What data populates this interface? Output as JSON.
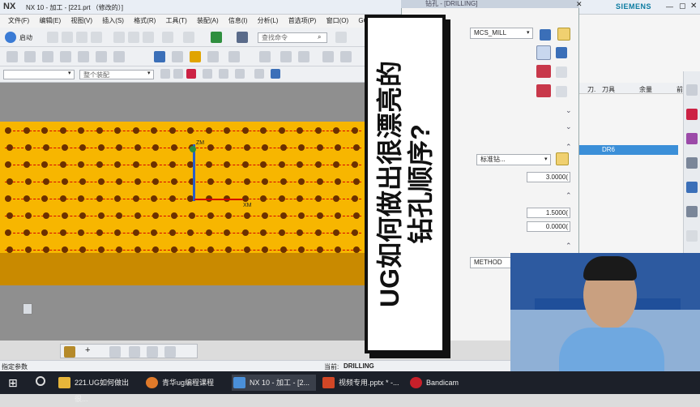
{
  "window": {
    "logo": "NX",
    "title": "NX 10 - 加工 - [221.prt （修改的）]",
    "brand": "SIEMENS"
  },
  "menu": [
    "文件(F)",
    "编辑(E)",
    "视图(V)",
    "插入(S)",
    "格式(R)",
    "工具(T)",
    "装配(A)",
    "信息(I)",
    "分析(L)",
    "首选项(P)",
    "窗口(O)",
    "GC工具箱"
  ],
  "toolbar": {
    "start_label": "启动",
    "search_placeholder": "查找命令",
    "filter1": "",
    "filter2": "整个装配"
  },
  "dialog": {
    "title": "钻孔 - [DRILLING]",
    "geometry_value": "MCS_MILL",
    "cycle_value": "标准钻...",
    "value1": "3.0000(",
    "value2": "1.5000(",
    "value3": "0.0000(",
    "method_value": "METHOD"
  },
  "tool_panel": {
    "col1": "刀.",
    "col2": "刀具",
    "col3": "余量",
    "col4": "前",
    "selected_tool": "DR6"
  },
  "status": {
    "left": "指定参数",
    "current_label": "当前:",
    "current_value": "DRILLING"
  },
  "overlay": {
    "line1": "UG如何做出很漂亮的",
    "line2": "钻孔顺序?"
  },
  "axis_labels": {
    "zm": "ZM",
    "xm": "XM"
  },
  "taskbar": {
    "items": [
      "221.UG如何做出很...",
      "青华ug编程课程",
      "NX 10 - 加工 - [2...",
      "视频专用.pptx * -...",
      "Bandicam"
    ]
  },
  "colors": {
    "slab": "#f7b600",
    "hole": "#6b3000",
    "toolpath": "#d40000",
    "selection": "#3b8fd8"
  }
}
